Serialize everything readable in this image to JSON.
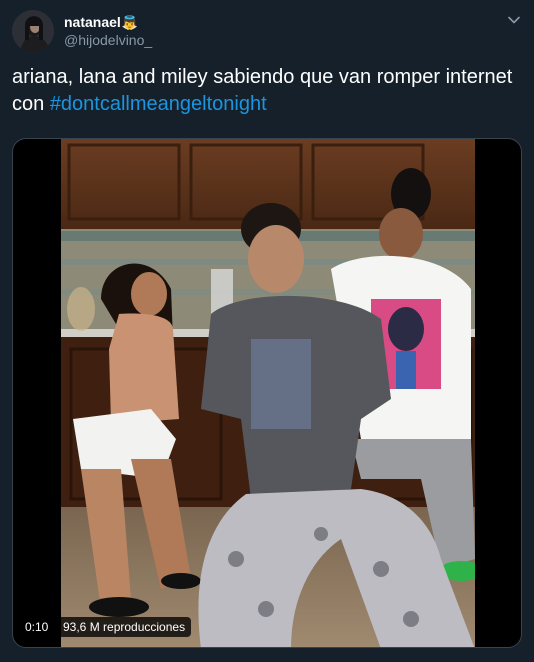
{
  "tweet": {
    "display_name": "natanael",
    "name_emoji": "👼",
    "handle": "@hijodelvino_",
    "text_plain": "ariana, lana and miley sabiendo que van romper internet con ",
    "hashtag": "#dontcallmeangeltonight"
  },
  "video": {
    "duration": "0:10",
    "views": "93,6 M reproducciones"
  },
  "icons": {
    "menu": "chevron-down-icon",
    "avatar": "avatar"
  },
  "colors": {
    "background": "#15202b",
    "text": "#ffffff",
    "muted": "#8899a6",
    "link": "#1b95e0",
    "border": "#38444d"
  }
}
